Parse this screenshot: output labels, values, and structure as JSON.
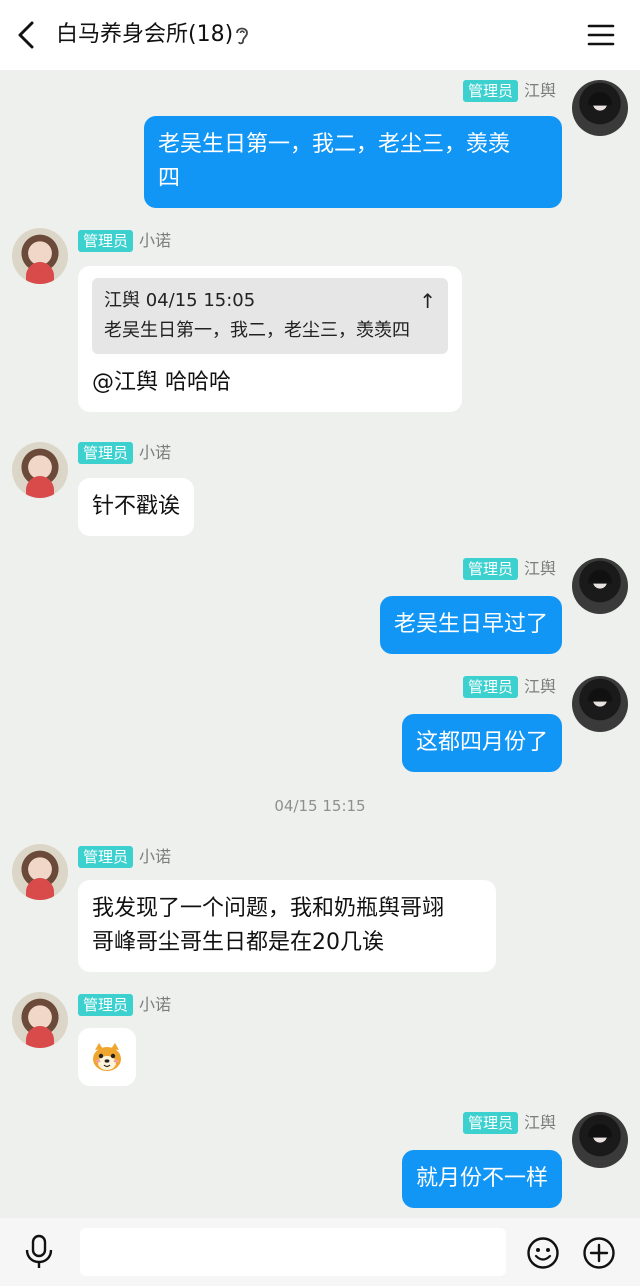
{
  "header": {
    "title": "白马养身会所(18)"
  },
  "timestamp_divider": "04/15 15:15",
  "messages": [
    {
      "side": "right",
      "badge": "管理员",
      "nick": "江舆",
      "lines": [
        "老吴生日第一，我二，老尘三，羡羡",
        "四"
      ]
    },
    {
      "side": "left",
      "badge": "管理员",
      "nick": "小诺",
      "quote": {
        "meta": "江舆 04/15 15:05",
        "text": "老吴生日第一，我二，老尘三，羡羡四"
      },
      "text": "@江舆 哈哈哈"
    },
    {
      "side": "left",
      "badge": "管理员",
      "nick": "小诺",
      "text": "针不戳诶"
    },
    {
      "side": "right",
      "badge": "管理员",
      "nick": "江舆",
      "text": "老吴生日早过了"
    },
    {
      "side": "right",
      "badge": "管理员",
      "nick": "江舆",
      "text": "这都四月份了"
    },
    {
      "side": "left",
      "badge": "管理员",
      "nick": "小诺",
      "lines": [
        "我发现了一个问题，我和奶瓶舆哥翊",
        "哥峰哥尘哥生日都是在20几诶"
      ]
    },
    {
      "side": "left",
      "badge": "管理员",
      "nick": "小诺",
      "emoji": "dog-face-emoji"
    },
    {
      "side": "right",
      "badge": "管理员",
      "nick": "江舆",
      "text": "就月份不一样"
    }
  ],
  "input": {
    "placeholder": ""
  },
  "colors": {
    "badge": "#3cd0cf",
    "own_bubble": "#1296f6",
    "background": "#edf0ed"
  }
}
